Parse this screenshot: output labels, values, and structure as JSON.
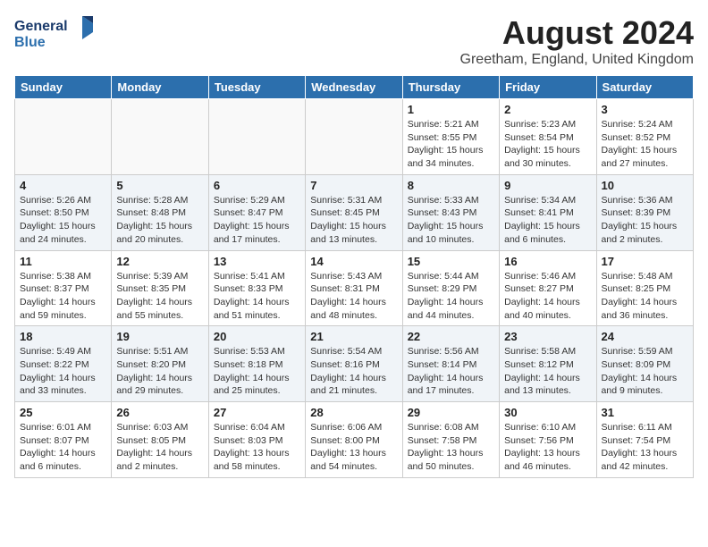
{
  "header": {
    "logo_line1": "General",
    "logo_line2": "Blue",
    "month_year": "August 2024",
    "location": "Greetham, England, United Kingdom"
  },
  "weekdays": [
    "Sunday",
    "Monday",
    "Tuesday",
    "Wednesday",
    "Thursday",
    "Friday",
    "Saturday"
  ],
  "weeks": [
    [
      {
        "day": "",
        "info": ""
      },
      {
        "day": "",
        "info": ""
      },
      {
        "day": "",
        "info": ""
      },
      {
        "day": "",
        "info": ""
      },
      {
        "day": "1",
        "info": "Sunrise: 5:21 AM\nSunset: 8:55 PM\nDaylight: 15 hours\nand 34 minutes."
      },
      {
        "day": "2",
        "info": "Sunrise: 5:23 AM\nSunset: 8:54 PM\nDaylight: 15 hours\nand 30 minutes."
      },
      {
        "day": "3",
        "info": "Sunrise: 5:24 AM\nSunset: 8:52 PM\nDaylight: 15 hours\nand 27 minutes."
      }
    ],
    [
      {
        "day": "4",
        "info": "Sunrise: 5:26 AM\nSunset: 8:50 PM\nDaylight: 15 hours\nand 24 minutes."
      },
      {
        "day": "5",
        "info": "Sunrise: 5:28 AM\nSunset: 8:48 PM\nDaylight: 15 hours\nand 20 minutes."
      },
      {
        "day": "6",
        "info": "Sunrise: 5:29 AM\nSunset: 8:47 PM\nDaylight: 15 hours\nand 17 minutes."
      },
      {
        "day": "7",
        "info": "Sunrise: 5:31 AM\nSunset: 8:45 PM\nDaylight: 15 hours\nand 13 minutes."
      },
      {
        "day": "8",
        "info": "Sunrise: 5:33 AM\nSunset: 8:43 PM\nDaylight: 15 hours\nand 10 minutes."
      },
      {
        "day": "9",
        "info": "Sunrise: 5:34 AM\nSunset: 8:41 PM\nDaylight: 15 hours\nand 6 minutes."
      },
      {
        "day": "10",
        "info": "Sunrise: 5:36 AM\nSunset: 8:39 PM\nDaylight: 15 hours\nand 2 minutes."
      }
    ],
    [
      {
        "day": "11",
        "info": "Sunrise: 5:38 AM\nSunset: 8:37 PM\nDaylight: 14 hours\nand 59 minutes."
      },
      {
        "day": "12",
        "info": "Sunrise: 5:39 AM\nSunset: 8:35 PM\nDaylight: 14 hours\nand 55 minutes."
      },
      {
        "day": "13",
        "info": "Sunrise: 5:41 AM\nSunset: 8:33 PM\nDaylight: 14 hours\nand 51 minutes."
      },
      {
        "day": "14",
        "info": "Sunrise: 5:43 AM\nSunset: 8:31 PM\nDaylight: 14 hours\nand 48 minutes."
      },
      {
        "day": "15",
        "info": "Sunrise: 5:44 AM\nSunset: 8:29 PM\nDaylight: 14 hours\nand 44 minutes."
      },
      {
        "day": "16",
        "info": "Sunrise: 5:46 AM\nSunset: 8:27 PM\nDaylight: 14 hours\nand 40 minutes."
      },
      {
        "day": "17",
        "info": "Sunrise: 5:48 AM\nSunset: 8:25 PM\nDaylight: 14 hours\nand 36 minutes."
      }
    ],
    [
      {
        "day": "18",
        "info": "Sunrise: 5:49 AM\nSunset: 8:22 PM\nDaylight: 14 hours\nand 33 minutes."
      },
      {
        "day": "19",
        "info": "Sunrise: 5:51 AM\nSunset: 8:20 PM\nDaylight: 14 hours\nand 29 minutes."
      },
      {
        "day": "20",
        "info": "Sunrise: 5:53 AM\nSunset: 8:18 PM\nDaylight: 14 hours\nand 25 minutes."
      },
      {
        "day": "21",
        "info": "Sunrise: 5:54 AM\nSunset: 8:16 PM\nDaylight: 14 hours\nand 21 minutes."
      },
      {
        "day": "22",
        "info": "Sunrise: 5:56 AM\nSunset: 8:14 PM\nDaylight: 14 hours\nand 17 minutes."
      },
      {
        "day": "23",
        "info": "Sunrise: 5:58 AM\nSunset: 8:12 PM\nDaylight: 14 hours\nand 13 minutes."
      },
      {
        "day": "24",
        "info": "Sunrise: 5:59 AM\nSunset: 8:09 PM\nDaylight: 14 hours\nand 9 minutes."
      }
    ],
    [
      {
        "day": "25",
        "info": "Sunrise: 6:01 AM\nSunset: 8:07 PM\nDaylight: 14 hours\nand 6 minutes."
      },
      {
        "day": "26",
        "info": "Sunrise: 6:03 AM\nSunset: 8:05 PM\nDaylight: 14 hours\nand 2 minutes."
      },
      {
        "day": "27",
        "info": "Sunrise: 6:04 AM\nSunset: 8:03 PM\nDaylight: 13 hours\nand 58 minutes."
      },
      {
        "day": "28",
        "info": "Sunrise: 6:06 AM\nSunset: 8:00 PM\nDaylight: 13 hours\nand 54 minutes."
      },
      {
        "day": "29",
        "info": "Sunrise: 6:08 AM\nSunset: 7:58 PM\nDaylight: 13 hours\nand 50 minutes."
      },
      {
        "day": "30",
        "info": "Sunrise: 6:10 AM\nSunset: 7:56 PM\nDaylight: 13 hours\nand 46 minutes."
      },
      {
        "day": "31",
        "info": "Sunrise: 6:11 AM\nSunset: 7:54 PM\nDaylight: 13 hours\nand 42 minutes."
      }
    ]
  ]
}
